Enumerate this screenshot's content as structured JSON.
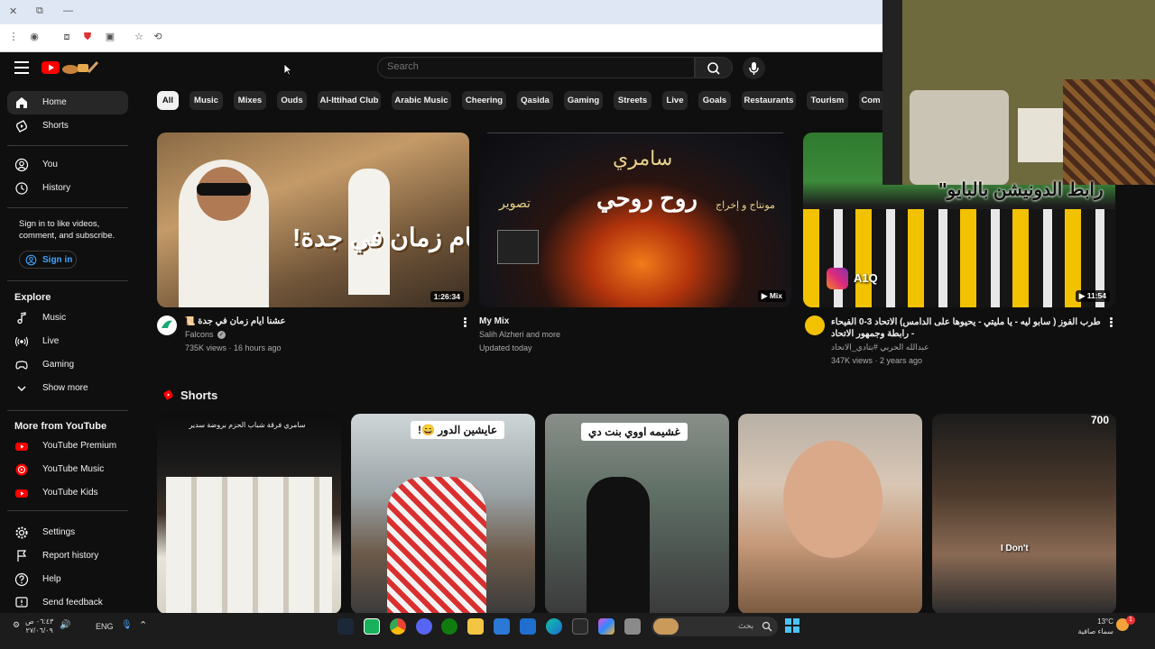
{
  "browser": {
    "window_controls": [
      "✕",
      "⧉",
      "—"
    ]
  },
  "header": {
    "search_placeholder": "Search"
  },
  "sidebar": {
    "main": [
      {
        "label": "Home",
        "icon": "home-icon"
      },
      {
        "label": "Shorts",
        "icon": "shorts-icon"
      }
    ],
    "you": [
      {
        "label": "You",
        "icon": "person-icon"
      },
      {
        "label": "History",
        "icon": "history-icon"
      }
    ],
    "signin_prompt": "Sign in to like videos, comment, and subscribe.",
    "signin_label": "Sign in",
    "explore_heading": "Explore",
    "explore": [
      {
        "label": "Music",
        "icon": "music-icon"
      },
      {
        "label": "Live",
        "icon": "live-icon"
      },
      {
        "label": "Gaming",
        "icon": "gaming-icon"
      },
      {
        "label": "Show more",
        "icon": "chevron-down-icon"
      }
    ],
    "more_heading": "More from YouTube",
    "more": [
      {
        "label": "YouTube Premium"
      },
      {
        "label": "YouTube Music"
      },
      {
        "label": "YouTube Kids"
      }
    ],
    "settings": [
      {
        "label": "Settings",
        "icon": "gear-icon"
      },
      {
        "label": "Report history",
        "icon": "flag-icon"
      },
      {
        "label": "Help",
        "icon": "help-icon"
      },
      {
        "label": "Send feedback",
        "icon": "feedback-icon"
      }
    ]
  },
  "chips": [
    "All",
    "Music",
    "Mixes",
    "Ouds",
    "Al-Ittihad Club",
    "Arabic Music",
    "Cheering",
    "Qasida",
    "Gaming",
    "Streets",
    "Live",
    "Goals",
    "Restaurants",
    "Tourism",
    "Com"
  ],
  "videos": [
    {
      "title": "عشنا أيام زمان في جدة 📜",
      "channel": "Falcons",
      "meta": "735K views · 16 hours ago",
      "duration": "1:26:34",
      "thumb_text": "أيام زمان في جدة!"
    },
    {
      "title": "My Mix",
      "channel": "Salih Alzheri and more",
      "meta": "Updated today",
      "duration": "Mix",
      "thumb_text_1": "سامري",
      "thumb_text_2": "روح روحي",
      "thumb_text_3": "تصوير",
      "thumb_text_4": "مونتاج و إخراج"
    },
    {
      "title": "طرب الفوز ( سابو ليه - يا مليتي - يحيوها على الدامس) الاتحاد 3-0 الفيحاء - رابطة وجمهور الاتحاد",
      "channel": "عبدالله الحربي #بتادي_الاتحاد",
      "meta": "347K views · 2 years ago",
      "duration": "11:54",
      "thumb_text": "A1Q"
    }
  ],
  "shorts": {
    "heading": "Shorts",
    "items": [
      {
        "caption": "سامري فرقة شباب الحزم بروضة سدير"
      },
      {
        "caption": "عايشين الدور 😄!"
      },
      {
        "caption": "غشيمه اووي بنت دي"
      },
      {
        "caption": ""
      },
      {
        "caption": "I Don't",
        "badge": "700"
      }
    ]
  },
  "overlay": {
    "text": "رابط الدونيشن بالبايو\""
  },
  "taskbar": {
    "time": "٠٦:٤٣ ص",
    "date": "٢٧/٠٦/٠٩",
    "lang": "ENG",
    "search_placeholder": "بحث",
    "weather_temp": "13°C",
    "weather_desc": "سماء صافية"
  },
  "colors": {
    "background": "#0f0f0f",
    "accent_red": "#ff0000",
    "chip_bg": "#272727",
    "signin_blue": "#3ea6ff"
  }
}
